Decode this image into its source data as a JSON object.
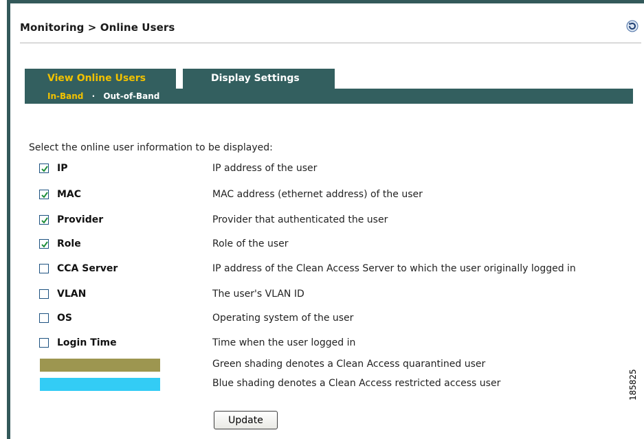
{
  "header": {
    "breadcrumb": "Monitoring > Online Users",
    "refresh_icon": "refresh-icon"
  },
  "tabs": [
    {
      "label": "View Online Users",
      "active": false
    },
    {
      "label": "Display Settings",
      "active": true
    }
  ],
  "subnav": {
    "items": [
      {
        "label": "In-Band",
        "active": true
      },
      {
        "label": "Out-of-Band",
        "active": false
      }
    ],
    "separator": "·"
  },
  "main": {
    "instruction": "Select the online user information to be displayed:",
    "options": [
      {
        "label": "IP",
        "description": "IP address of the user",
        "checked": true
      },
      {
        "label": "MAC",
        "description": "MAC address (ethernet address) of the user",
        "checked": true
      },
      {
        "label": "Provider",
        "description": "Provider that authenticated the user",
        "checked": true
      },
      {
        "label": "Role",
        "description": "Role of the user",
        "checked": true
      },
      {
        "label": "CCA Server",
        "description": "IP address of the Clean Access Server to which the user originally logged in",
        "checked": false
      },
      {
        "label": "VLAN",
        "description": "The user's VLAN ID",
        "checked": false
      },
      {
        "label": "OS",
        "description": "Operating system of the user",
        "checked": false
      },
      {
        "label": "Login Time",
        "description": "Time when the user logged in",
        "checked": false
      }
    ],
    "legend": [
      {
        "color": "#9d9650",
        "description": "Green shading denotes a Clean Access quarantined user"
      },
      {
        "color": "#33ccf5",
        "description": "Blue shading denotes a Clean Access restricted access user"
      }
    ],
    "update_label": "Update"
  },
  "figure_number": "185825",
  "colors": {
    "frame": "#33595a",
    "tab_bg": "#335f5f",
    "tab_active_text": "#ffffff",
    "tab_inactive_text": "#f2c200",
    "checkmark": "#1f8f3a"
  }
}
